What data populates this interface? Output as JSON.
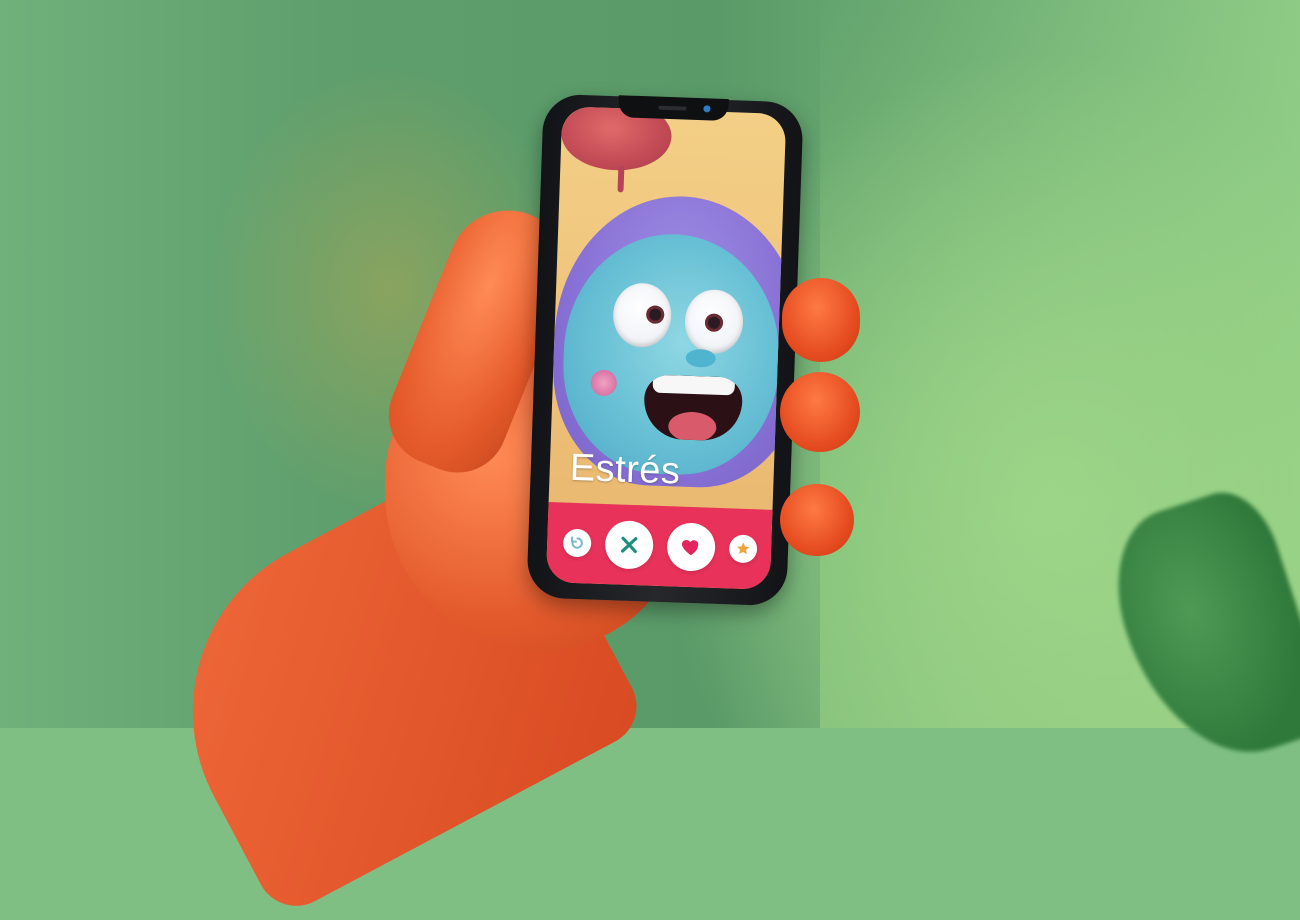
{
  "app": {
    "profile": {
      "name": "Estrés"
    },
    "actions": {
      "rewind_icon": "rewind-icon",
      "nope_icon": "x-icon",
      "like_icon": "heart-icon",
      "superlike_icon": "star-icon"
    },
    "colors": {
      "action_bar": "#e9325a",
      "nope": "#1e8f7e",
      "like": "#e4245c",
      "superlike": "#f2a33a",
      "rewind": "#7bb9d1"
    }
  }
}
